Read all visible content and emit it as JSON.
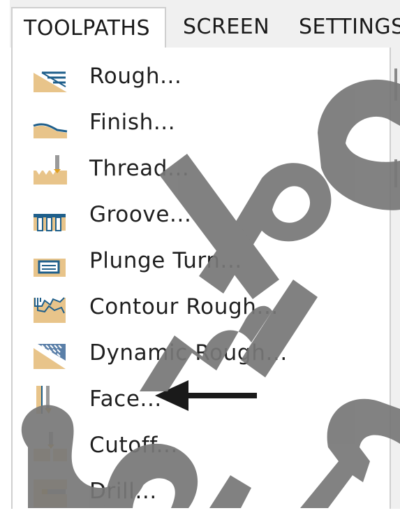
{
  "menubar": {
    "tabs": [
      {
        "label": "TOOLPATHS",
        "active": true
      },
      {
        "label": "SCREEN",
        "active": false
      },
      {
        "label": "SETTINGS",
        "active": false
      }
    ]
  },
  "menu": {
    "items": [
      {
        "label": "Rough...",
        "icon": "rough-icon"
      },
      {
        "label": "Finish...",
        "icon": "finish-icon"
      },
      {
        "label": "Thread...",
        "icon": "thread-icon"
      },
      {
        "label": "Groove...",
        "icon": "groove-icon"
      },
      {
        "label": "Plunge Turn...",
        "icon": "plunge-turn-icon"
      },
      {
        "label": "Contour Rough...",
        "icon": "contour-rough-icon"
      },
      {
        "label": "Dynamic Rough...",
        "icon": "dynamic-rough-icon"
      },
      {
        "label": "Face...",
        "icon": "face-icon"
      },
      {
        "label": "Cutoff...",
        "icon": "cutoff-icon"
      },
      {
        "label": "Drill...",
        "icon": "drill-icon"
      }
    ]
  },
  "annotation": {
    "arrow_target": "Face...",
    "arrow_color": "#1a1a1a"
  },
  "colors": {
    "icon_fill": "#e8c48a",
    "icon_outline": "#1f5f8b",
    "watermark": "#777777"
  },
  "watermark": {
    "text": "Sample"
  }
}
